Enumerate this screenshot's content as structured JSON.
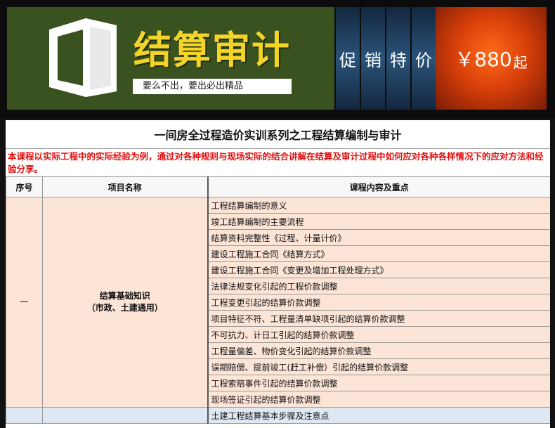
{
  "banner": {
    "title": "结算审计",
    "slogan": "要么不出，要出必出精品",
    "promo_chars": [
      "促",
      "销",
      "特",
      "价"
    ],
    "price": "￥880",
    "price_suffix": "起",
    "colors": {
      "title": "#f5d428",
      "panel": "#39521f",
      "promo": "#2a5278",
      "price_box": "#e0480c"
    }
  },
  "document": {
    "title": "一间房全过程造价实训系列之工程结算编制与审计",
    "intro": "本课程以实际工程中的实际经验为例，通过对各种规则与现场实际的结合讲解在结算及审计过程中如何应对各种各样情况下的应对方法和经验分享。",
    "columns": {
      "seq": "序号",
      "name": "项目名称",
      "content": "课程内容及重点"
    },
    "section1": {
      "seq": "一",
      "name_line1": "结算基础知识",
      "name_line2": "（市政、土建通用）",
      "items": [
        "工程结算编制的意义",
        "竣工结算编制的主要流程",
        "结算资料完整性《过程、计量计价》",
        "建设工程施工合同《结算方式》",
        "建设工程施工合同《变更及增加工程处理方式》",
        "法律法规变化引起的工程价款调整",
        "工程变更引起的结算价款调整",
        "项目特征不符、工程量清单缺项引起的结算价款调整",
        "不可抗力、计日工引起的结算价款调整",
        "工程量偏差、物价变化引起的结算价款调整",
        "误期赔偿、提前竣工(赶工补偿）引起的结算价款调整",
        "工程索赔事件引起的结算价款调整",
        "现场签证引起的结算价款调整"
      ]
    },
    "section2": {
      "items": [
        "土建工程结算基本步骤及注意点"
      ]
    },
    "colors": {
      "intro_text": "#e01010",
      "section1_bg": "#fce4d6",
      "section2_bg": "#dde8f3"
    }
  }
}
